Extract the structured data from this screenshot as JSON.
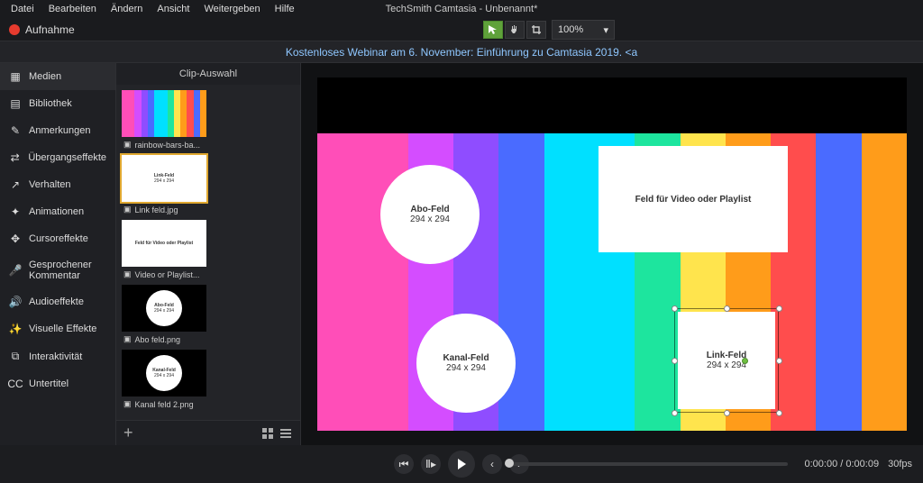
{
  "app_title": "TechSmith Camtasia - Unbenannt*",
  "menu": [
    "Datei",
    "Bearbeiten",
    "Ändern",
    "Ansicht",
    "Weitergeben",
    "Hilfe"
  ],
  "record_label": "Aufnahme",
  "zoom_value": "100%",
  "banner_text": "Kostenloses Webinar am 6. November: Einführung zu Camtasia 2019. <a",
  "sidebar": [
    {
      "icon": "▦",
      "label": "Medien",
      "active": true
    },
    {
      "icon": "▤",
      "label": "Bibliothek"
    },
    {
      "icon": "✎",
      "label": "Anmerkungen"
    },
    {
      "icon": "⇄",
      "label": "Übergangseffekte"
    },
    {
      "icon": "↗",
      "label": "Verhalten"
    },
    {
      "icon": "✦",
      "label": "Animationen"
    },
    {
      "icon": "✥",
      "label": "Cursoreffekte"
    },
    {
      "icon": "🎤",
      "label": "Gesprochener Kommentar"
    },
    {
      "icon": "🔊",
      "label": "Audioeffekte"
    },
    {
      "icon": "✨",
      "label": "Visuelle Effekte"
    },
    {
      "icon": "⧉",
      "label": "Interaktivität"
    },
    {
      "icon": "CC",
      "label": "Untertitel"
    }
  ],
  "bin_header": "Clip-Auswahl",
  "thumbs": [
    {
      "name": "rainbow-bars-ba...",
      "kind": "rainbow"
    },
    {
      "name": "Link feld.jpg",
      "kind": "rect",
      "t": "Link-Feld",
      "d": "294 x 294",
      "selected": true
    },
    {
      "name": "Video or Playlist...",
      "kind": "rect",
      "t": "Feld für Video oder Playlist",
      "d": ""
    },
    {
      "name": "Abo feld.png",
      "kind": "circle",
      "t": "Abo-Feld",
      "d": "294 x 294"
    },
    {
      "name": "Kanal feld 2.png",
      "kind": "circle",
      "t": "Kanal-Feld",
      "d": "294 x 294"
    }
  ],
  "canvas": {
    "abo": {
      "title": "Abo-Feld",
      "dim": "294 x 294"
    },
    "kanal": {
      "title": "Kanal-Feld",
      "dim": "294 x 294"
    },
    "video": {
      "title": "Feld für Video oder Playlist"
    },
    "link": {
      "title": "Link-Feld",
      "dim": "294 x 294"
    }
  },
  "playback": {
    "time": "0:00:00 / 0:00:09",
    "fps": "30fps"
  },
  "colors": {
    "bars": [
      "#ff4eb8",
      "#ff4eb8",
      "#d44dff",
      "#8f4dff",
      "#4a6bff",
      "#00e0ff",
      "#00e0ff",
      "#1de59e",
      "#ffe44d",
      "#ff9c1a",
      "#ff4d4d",
      "#4a6bff",
      "#ff9c1a"
    ]
  }
}
